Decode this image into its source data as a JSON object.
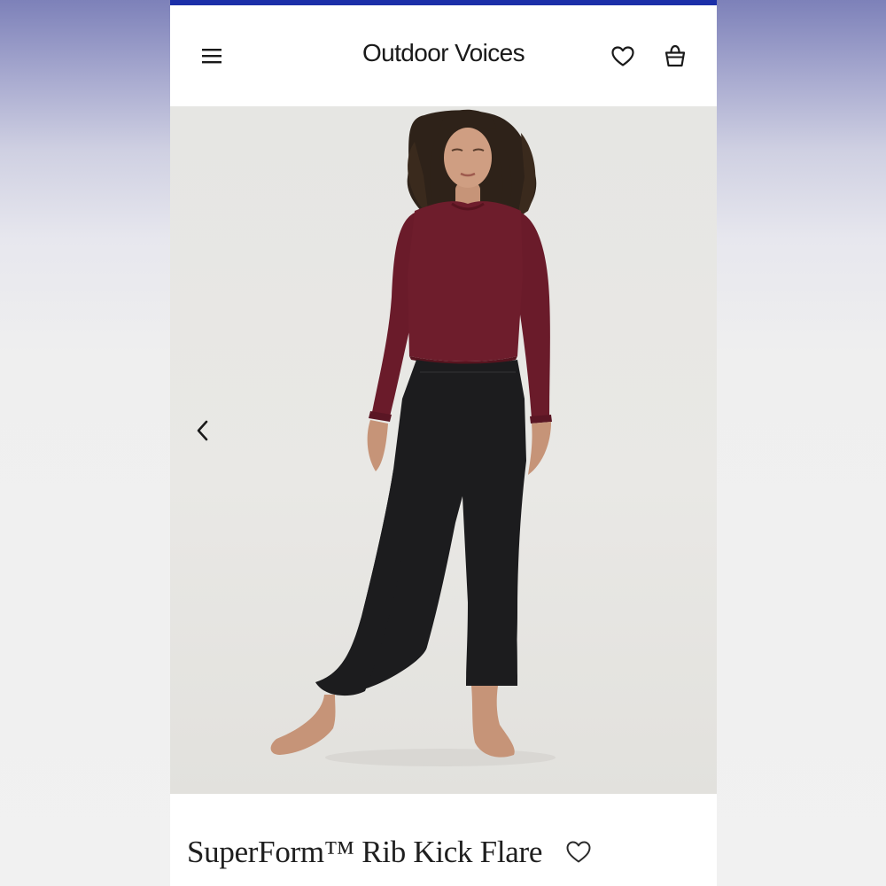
{
  "header": {
    "brand": "Outdoor Voices",
    "icons": {
      "menu": "hamburger-menu-icon",
      "wishlist": "heart-icon",
      "bag": "shopping-bag-icon"
    }
  },
  "gallery": {
    "prev_icon": "chevron-left-icon",
    "image_subject": "model wearing burgundy long-sleeve top and black flare pants"
  },
  "product": {
    "title": "SuperForm™ Rib Kick Flare",
    "wishlist_icon": "heart-outline-icon"
  },
  "colors": {
    "accent_strip": "#1b2fa8",
    "top": "#6e1d2c",
    "pants": "#1c1c1e",
    "text": "#1a1a1a"
  }
}
